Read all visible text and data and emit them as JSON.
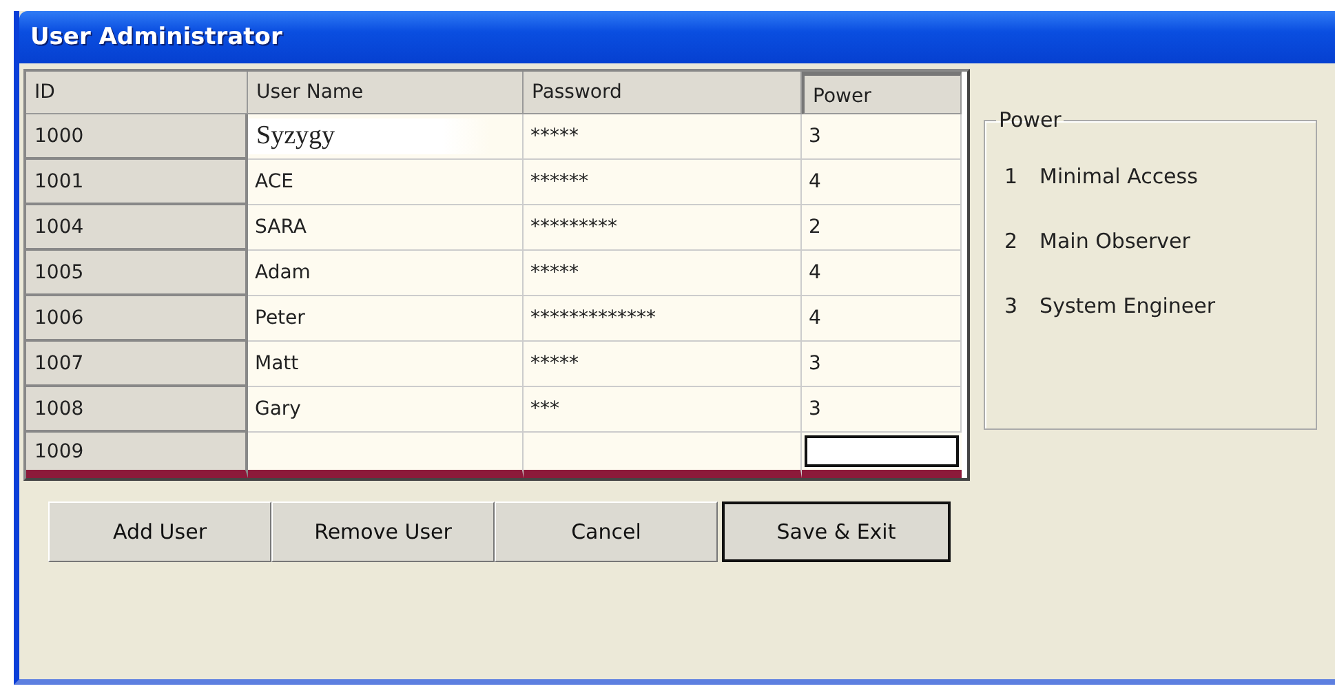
{
  "window": {
    "title": "User Administrator"
  },
  "table": {
    "columns": [
      {
        "label": "ID",
        "selected": false
      },
      {
        "label": "User Name",
        "selected": false
      },
      {
        "label": "Password",
        "selected": false
      },
      {
        "label": "Power",
        "selected": true
      }
    ],
    "rows": [
      {
        "kind": "editing",
        "id": "1000",
        "user_name": "Syzygy",
        "password": "*****",
        "power": "3"
      },
      {
        "kind": "record",
        "id": "1001",
        "user_name": "ACE",
        "password": "******",
        "power": "4"
      },
      {
        "kind": "record",
        "id": "1004",
        "user_name": "SARA",
        "password": "*********",
        "power": "2"
      },
      {
        "kind": "record",
        "id": "1005",
        "user_name": "Adam",
        "password": "*****",
        "power": "4"
      },
      {
        "kind": "record",
        "id": "1006",
        "user_name": "Peter",
        "password": "*************",
        "power": "4"
      },
      {
        "kind": "record",
        "id": "1007",
        "user_name": "Matt",
        "password": "*****",
        "power": "3"
      },
      {
        "kind": "record",
        "id": "1008",
        "user_name": "Gary",
        "password": "***",
        "power": "3"
      },
      {
        "kind": "new",
        "id": "1009"
      }
    ]
  },
  "power_legend": {
    "title": "Power",
    "items": [
      {
        "level_number": "1",
        "label": "Minimal Access"
      },
      {
        "level_number": "2",
        "label": "Main Observer"
      },
      {
        "level_number": "3",
        "label": "System Engineer"
      }
    ]
  },
  "buttons": [
    {
      "label": "Add User",
      "default": false
    },
    {
      "label": "Remove User",
      "default": false
    },
    {
      "label": "Cancel",
      "default": false
    },
    {
      "label": "Save & Exit",
      "default": true
    }
  ]
}
